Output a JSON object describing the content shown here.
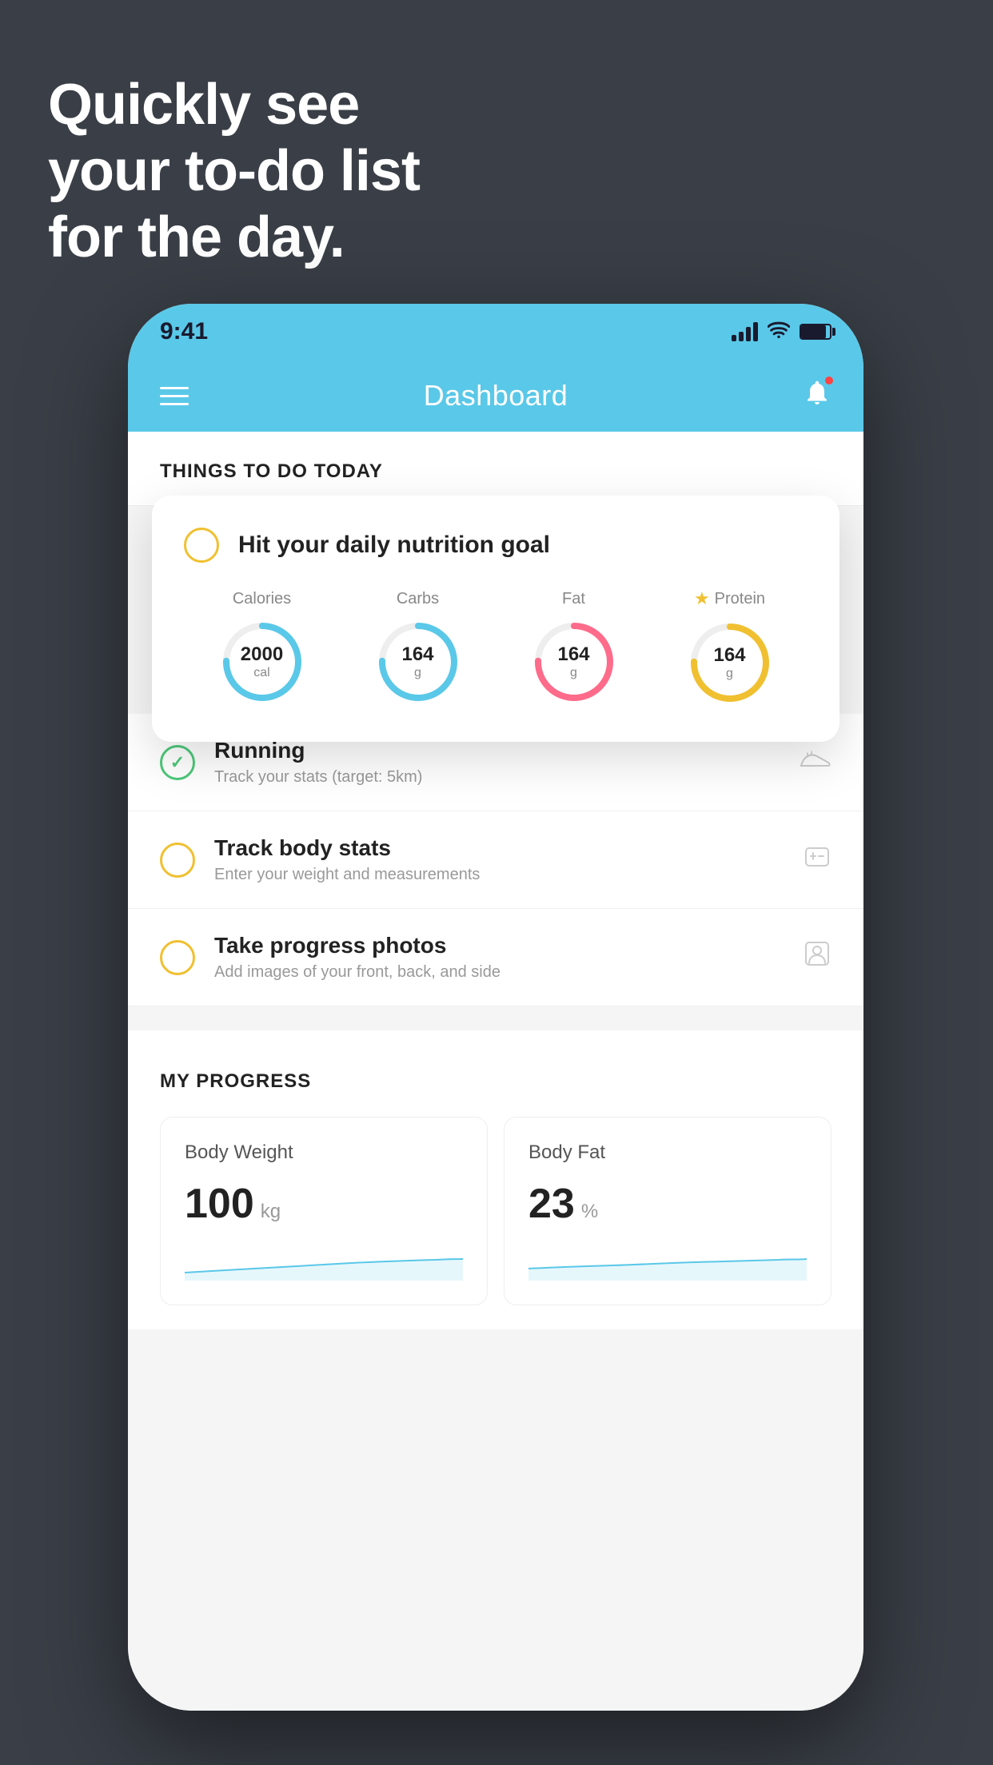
{
  "background": {
    "color": "#3a3f47"
  },
  "hero": {
    "line1": "Quickly see",
    "line2": "your to-do list",
    "line3": "for the day."
  },
  "phone": {
    "status_bar": {
      "time": "9:41"
    },
    "app_bar": {
      "title": "Dashboard"
    },
    "things_today": {
      "section_title": "THINGS TO DO TODAY"
    },
    "nutrition_card": {
      "title": "Hit your daily nutrition goal",
      "items": [
        {
          "label": "Calories",
          "value": "2000",
          "unit": "cal",
          "color": "blue",
          "starred": false
        },
        {
          "label": "Carbs",
          "value": "164",
          "unit": "g",
          "color": "blue",
          "starred": false
        },
        {
          "label": "Fat",
          "value": "164",
          "unit": "g",
          "color": "pink",
          "starred": false
        },
        {
          "label": "Protein",
          "value": "164",
          "unit": "g",
          "color": "gold",
          "starred": true
        }
      ]
    },
    "todo_items": [
      {
        "id": "running",
        "title": "Running",
        "subtitle": "Track your stats (target: 5km)",
        "checked": true,
        "icon": "shoe"
      },
      {
        "id": "body-stats",
        "title": "Track body stats",
        "subtitle": "Enter your weight and measurements",
        "checked": false,
        "icon": "scale"
      },
      {
        "id": "progress-photos",
        "title": "Take progress photos",
        "subtitle": "Add images of your front, back, and side",
        "checked": false,
        "icon": "person"
      }
    ],
    "progress": {
      "section_title": "MY PROGRESS",
      "cards": [
        {
          "title": "Body Weight",
          "value": "100",
          "unit": "kg"
        },
        {
          "title": "Body Fat",
          "value": "23",
          "unit": "%"
        }
      ]
    }
  }
}
